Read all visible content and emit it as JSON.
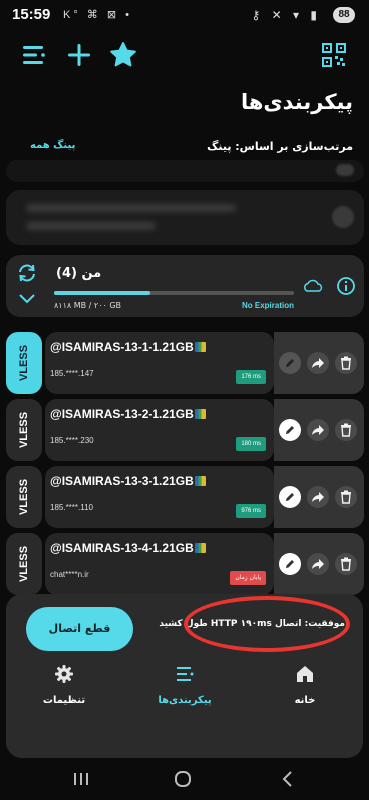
{
  "status_bar": {
    "time": "15:59",
    "left_icons": "K° ⌘ ⊠ •",
    "right_icons": "⚷ ✕ ▾ ▮",
    "battery": "88"
  },
  "toolbar": {
    "menu_icon": "menu-icon",
    "add_icon": "plus-icon",
    "favorite_icon": "star-icon",
    "qr_icon": "qr-scan-icon"
  },
  "page": {
    "title": "پیکربندی‌ها",
    "sort_label": "مرتب‌سازی بر اساس: پینگ",
    "ping_all": "پینگ همه"
  },
  "subscription": {
    "title": "من (4)",
    "usage": "۸۱۱۸ MB / ۲۰۰ GB",
    "progress": 0.4,
    "expiry": "No Expiration"
  },
  "servers": [
    {
      "type": "VLESS",
      "name": "@ISAMIRAS-13-1-1.21GB",
      "address": "185.****.147",
      "ping": "176 ms",
      "status": "ok",
      "active": true
    },
    {
      "type": "VLESS",
      "name": "@ISAMIRAS-13-2-1.21GB",
      "address": "185.****.230",
      "ping": "180 ms",
      "status": "ok",
      "active": false
    },
    {
      "type": "VLESS",
      "name": "@ISAMIRAS-13-3-1.21GB",
      "address": "185.****.110",
      "ping": "976 ms",
      "status": "ok",
      "active": false
    },
    {
      "type": "VLESS",
      "name": "@ISAMIRAS-13-4-1.21GB",
      "address": "chat****n.ir",
      "ping": "پایان زمان",
      "status": "error",
      "active": false
    }
  ],
  "connection": {
    "disconnect_label": "قطع اتصال",
    "status_message": "موفقیت: اتصال HTTP ۱۹۰ms طول کشید"
  },
  "bottom_nav": [
    {
      "label": "تنظیمات",
      "icon": "gear-icon",
      "active": false
    },
    {
      "label": "پیکربندی‌ها",
      "icon": "list-icon",
      "active": true
    },
    {
      "label": "خانه",
      "icon": "home-icon",
      "active": false
    }
  ],
  "colors": {
    "accent": "#56d9e8",
    "background": "#0b0b0b",
    "card": "#262626",
    "panel": "#2b2b2b",
    "highlight": "#e8352f"
  }
}
